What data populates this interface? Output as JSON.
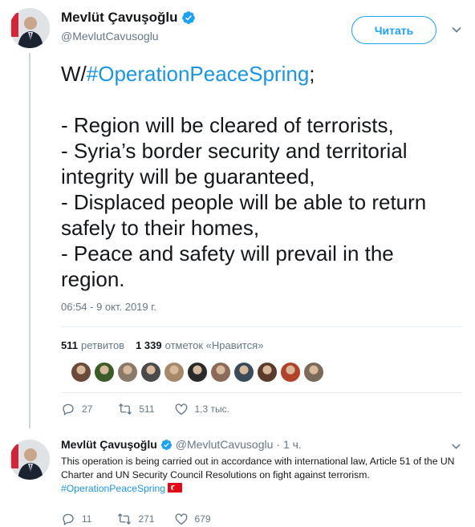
{
  "tweet": {
    "display_name": "Mevlüt Çavuşoğlu",
    "handle": "@MevlutCavusoglu",
    "follow_label": "Читать",
    "text_prefix": "W/",
    "hashtag": "#OperationPeaceSpring",
    "text_after_hashtag": ";\n\n- Region will be cleared of terrorists,\n- Syria’s border security and territorial integrity will be guaranteed,\n- Displaced people will be able to return safely to their homes,\n- Peace and safety will prevail in the region.",
    "timestamp": "06:54 - 9 окт. 2019 г.",
    "retweets_count": "511",
    "retweets_label": "ретвитов",
    "likes_count": "1 339",
    "likes_label": "отметок «Нравится»",
    "liker_colors": [
      "#6b4a3a",
      "#3d5a2a",
      "#8a7a6a",
      "#4a4a4a",
      "#a58a6a",
      "#2a2a2a",
      "#8a6a5a",
      "#3a4a5a",
      "#5a3a2a",
      "#b0442a",
      "#7a6a5a"
    ],
    "actions": {
      "replies": "27",
      "retweets": "511",
      "likes": "1,3 тыс."
    }
  },
  "reply": {
    "display_name": "Mevlüt Çavuşoğlu",
    "handle": "@MevlutCavusoglu",
    "time": "· 1 ч.",
    "text": "This operation is being carried out in accordance with international law, Article 51 of the UN Charter and UN Security Council Resolutions on fight against terrorism.",
    "hashtag": "#OperationPeaceSpring",
    "actions": {
      "replies": "11",
      "retweets": "271",
      "likes": "679"
    }
  },
  "colors": {
    "accent": "#1da1f2",
    "hashtag": "#1b95e0",
    "muted": "#657786",
    "flag_red": "#e30a17"
  },
  "icons": [
    "verified-badge-icon",
    "chevron-down-icon",
    "reply-icon",
    "retweet-icon",
    "heart-icon",
    "turkish-flag-icon"
  ]
}
